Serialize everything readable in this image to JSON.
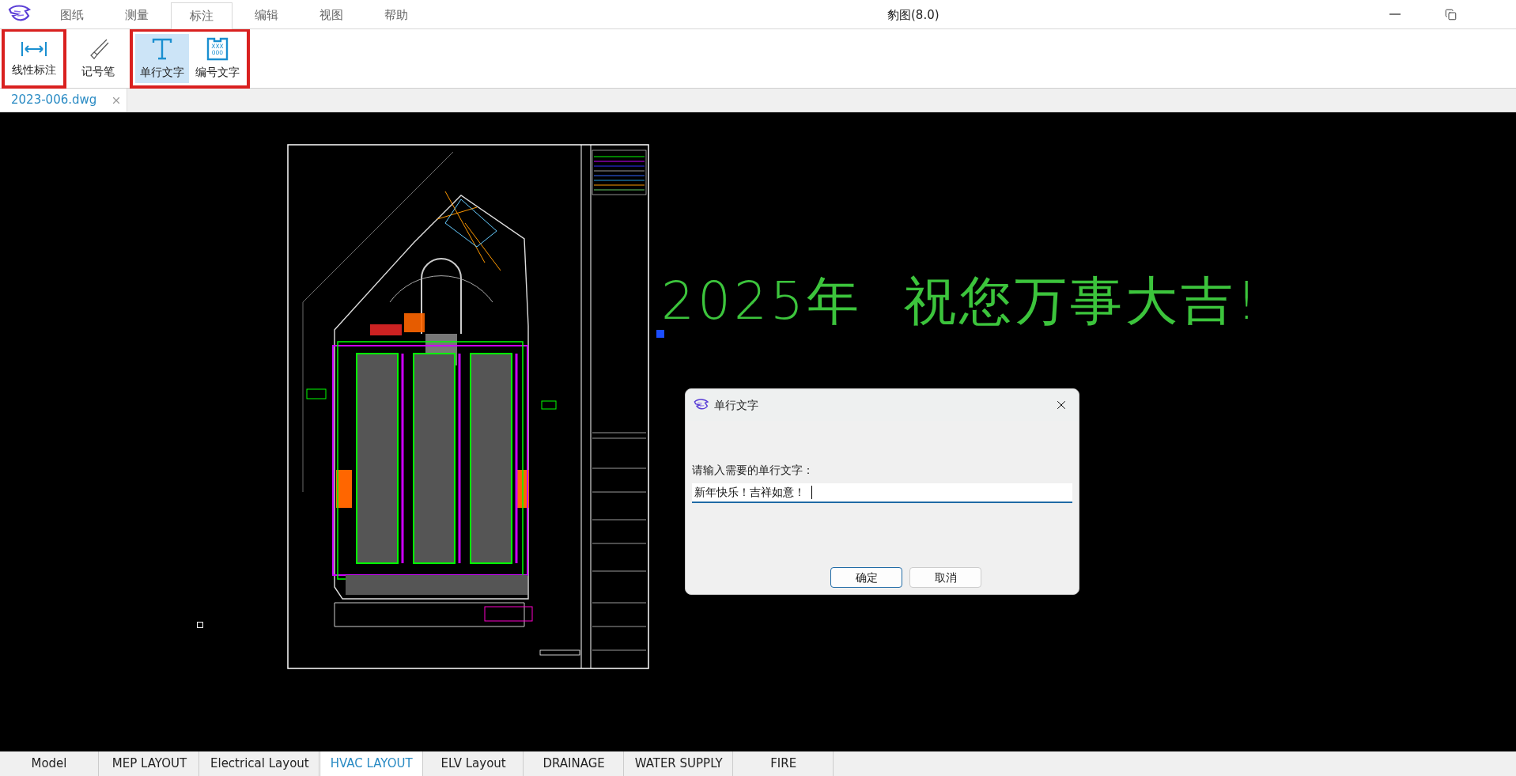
{
  "app": {
    "title": "豹图(8.0)"
  },
  "menu_tabs": [
    {
      "label": "图纸",
      "selected": false
    },
    {
      "label": "测量",
      "selected": false
    },
    {
      "label": "标注",
      "selected": true
    },
    {
      "label": "编辑",
      "selected": false
    },
    {
      "label": "视图",
      "selected": false
    },
    {
      "label": "帮助",
      "selected": false
    }
  ],
  "toolbar_groups": [
    {
      "highlighted": true,
      "buttons": [
        {
          "label": "线性标注",
          "kind": "dimension",
          "selected": false
        }
      ]
    },
    {
      "highlighted": false,
      "buttons": [
        {
          "label": "记号笔",
          "kind": "marker",
          "selected": false
        }
      ]
    },
    {
      "highlighted": true,
      "buttons": [
        {
          "label": "单行文字",
          "kind": "text",
          "selected": true
        },
        {
          "label": "编号文字",
          "kind": "numbered",
          "selected": false,
          "icon_text": [
            "XXX",
            "000"
          ]
        }
      ]
    }
  ],
  "doc_tabs": [
    {
      "label": "2023-006.dwg",
      "selected": true
    }
  ],
  "canvas": {
    "text": "2025年 祝您万事大吉!"
  },
  "dialog": {
    "title": "单行文字",
    "prompt": "请输入需要的单行文字：",
    "value": "新年快乐！吉祥如意！",
    "buttons": [
      {
        "label": "确定",
        "default": true
      },
      {
        "label": "取消",
        "default": false
      }
    ]
  },
  "layout_tabs": [
    {
      "label": "Model",
      "selected": false
    },
    {
      "label": "MEP LAYOUT",
      "selected": false
    },
    {
      "label": "Electrical Layout",
      "selected": false
    },
    {
      "label": "HVAC LAYOUT",
      "selected": true
    },
    {
      "label": "ELV Layout",
      "selected": false
    },
    {
      "label": "DRAINAGE",
      "selected": false
    },
    {
      "label": "WATER SUPPLY",
      "selected": false
    },
    {
      "label": "FIRE",
      "selected": false
    }
  ]
}
